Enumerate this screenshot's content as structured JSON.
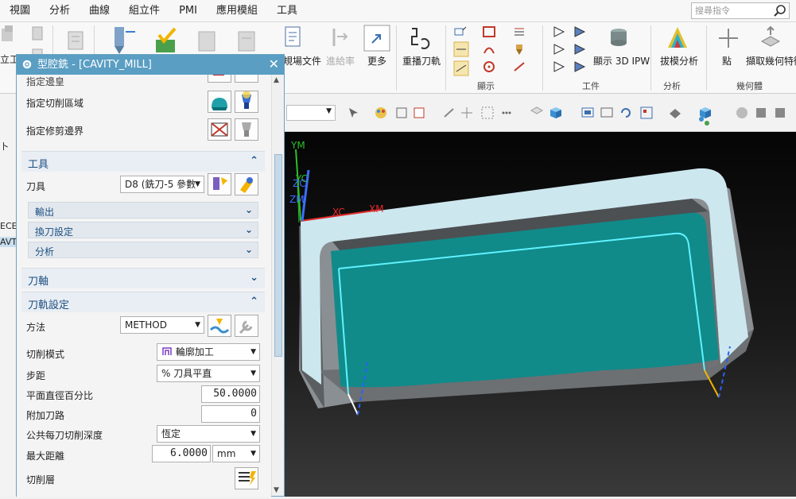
{
  "menu": {
    "items": [
      "視圖",
      "分析",
      "曲線",
      "組立件",
      "PMI",
      "應用模組",
      "工具"
    ],
    "search_placeholder": "搜尋指令"
  },
  "ribbon": {
    "left_partial": "立工",
    "simulate_doc": "規場文件",
    "feed_rate": "進給率",
    "more": "更多",
    "replay": "重播刀軌",
    "display_group": "顯示",
    "show_3d_ipw": "顯示 3D IPW",
    "workpiece_group": "工件",
    "draft_analysis": "拔模分析",
    "analysis_group": "分析",
    "point": "點",
    "extract_geometry": "擷取幾何特徵",
    "geometry_group": "幾何體"
  },
  "navstrip": {
    "partial_1": "ECE",
    "partial_2": "AVT",
    "partial_3": "卜"
  },
  "dialog": {
    "title": "型腔銑 - [CAVITY_MILL]",
    "rows": {
      "specify_part_partial": "指定邊皇",
      "specify_cut_area": "指定切削區域",
      "specify_trim_boundary": "指定修剪邊界"
    },
    "tool_section": {
      "title": "工具",
      "tool_label": "刀具",
      "tool_value": "D8 (銑刀-5 參數",
      "output": "輸出",
      "tool_change": "換刀設定",
      "analysis": "分析"
    },
    "axis_section": {
      "title": "刀軸"
    },
    "path_section": {
      "title": "刀軌設定",
      "method_label": "方法",
      "method_value": "METHOD",
      "cut_pattern_label": "切削模式",
      "cut_pattern_value": "輪廓加工",
      "stepover_label": "步距",
      "stepover_value": "% 刀具平直",
      "percent_label": "平面直徑百分比",
      "percent_value": "50.0000",
      "extra_passes_label": "附加刀路",
      "extra_passes_value": "0",
      "depth_label": "公共每刀切削深度",
      "depth_value": "恆定",
      "max_distance_label": "最大距離",
      "max_distance_value": "6.0000",
      "unit_value": "mm",
      "cut_levels_label": "切削層"
    }
  },
  "viewport": {
    "axis_labels": {
      "ym": "YM",
      "yc": "YC",
      "zc": "ZC",
      "zm": "ZM",
      "xc": "XC",
      "xm": "XM"
    }
  },
  "colors": {
    "title_bar": "#5a9ec3",
    "section_text": "#1d4f80",
    "pocket_floor": "#118a8a",
    "toolpath": "#5ff3ff",
    "model_body": "#8a8f93"
  }
}
